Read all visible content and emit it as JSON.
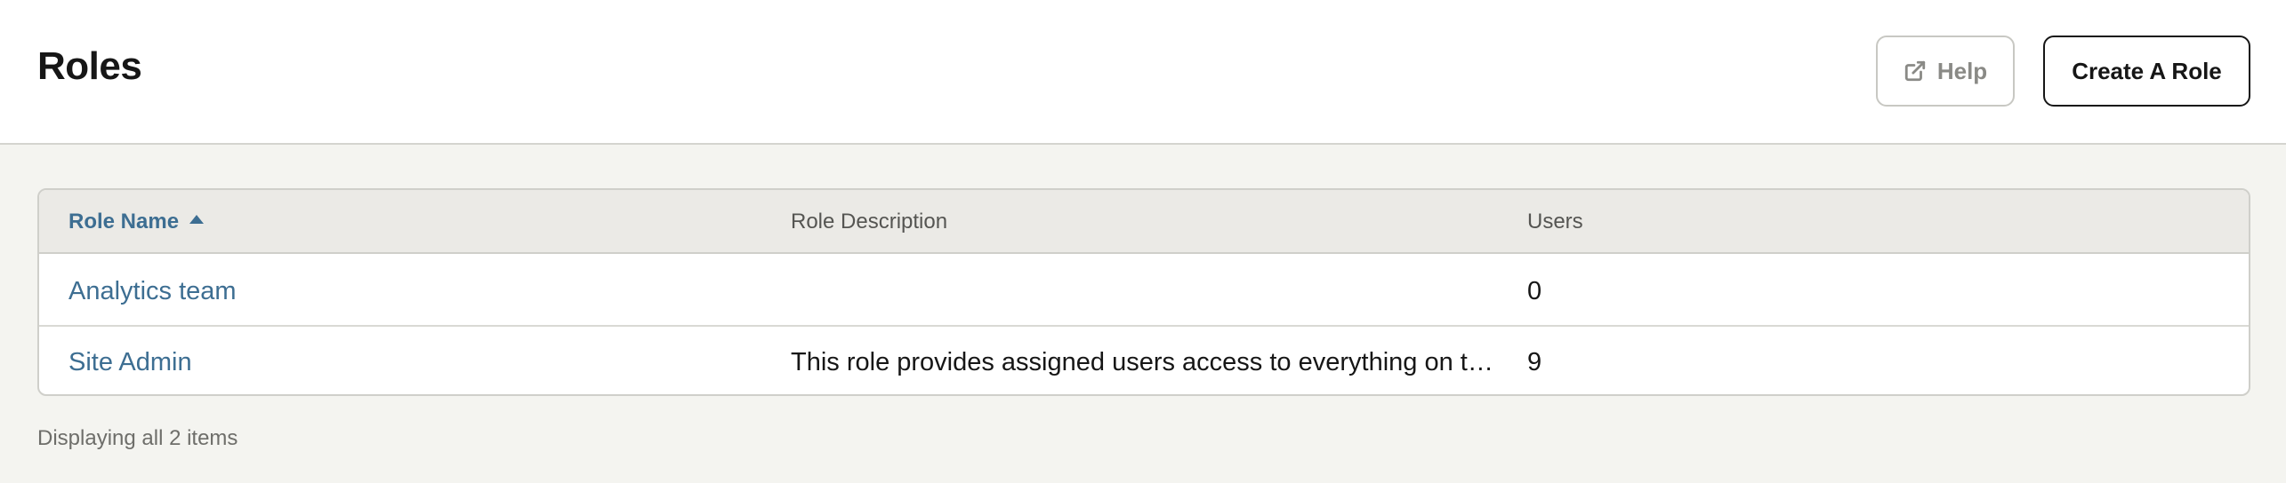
{
  "header": {
    "title": "Roles",
    "help_label": "Help",
    "help_icon": "external-link-icon",
    "create_label": "Create A Role"
  },
  "table": {
    "columns": [
      {
        "label": "Role Name",
        "sort": "ascending"
      },
      {
        "label": "Role Description"
      },
      {
        "label": "Users"
      }
    ],
    "rows": [
      {
        "name": "Analytics team",
        "description": "",
        "users": "0"
      },
      {
        "name": "Site Admin",
        "description": "This role provides assigned users access to everything on th…",
        "users": "9"
      }
    ]
  },
  "footer": {
    "summary": "Displaying all 2 items"
  },
  "colors": {
    "link": "#3d6e92",
    "background": "#f4f4f0",
    "header_bg": "#ffffff",
    "table_header_bg": "#ebeae6"
  }
}
